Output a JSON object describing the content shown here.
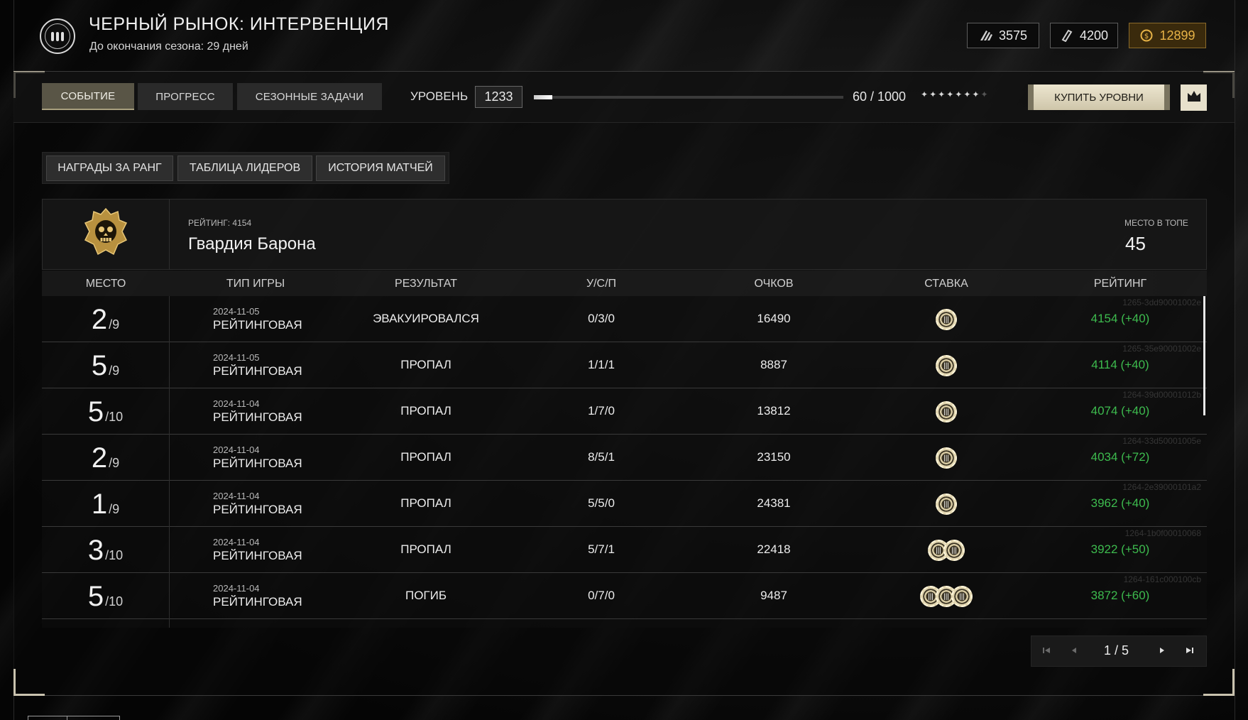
{
  "header": {
    "title": "ЧЕРНЫЙ РЫНОК: ИНТЕРВЕНЦИЯ",
    "subtitle": "До окончания сезона: 29 дней",
    "currencies": [
      {
        "icon": "ammo-icon",
        "value": "3575"
      },
      {
        "icon": "ticket-icon",
        "value": "4200"
      },
      {
        "icon": "gold-coin-icon",
        "value": "12899",
        "color": "#e7b347"
      }
    ]
  },
  "nav": {
    "tabs": [
      "СОБЫТИЕ",
      "ПРОГРЕСС",
      "СЕЗОННЫЕ ЗАДАЧИ"
    ],
    "active_tab": "СОБЫТИЕ",
    "level_label": "УРОВЕНЬ",
    "level_value": "1233",
    "progress_current": 60,
    "progress_max": 1000,
    "progress_text": "60 / 1000",
    "stars_filled": 7,
    "stars_total": 8,
    "buy_label": "КУПИТЬ УРОВНИ",
    "crown_icon": "crown-icon"
  },
  "subtabs": [
    "НАГРАДЫ ЗА РАНГ",
    "ТАБЛИЦА ЛИДЕРОВ",
    "ИСТОРИЯ МАТЧЕЙ"
  ],
  "team": {
    "rating_label": "РЕЙТИНГ: 4154",
    "name": "Гвардия Барона",
    "place_label": "МЕСТО В ТОПЕ",
    "place_value": "45",
    "emblem_icon": "skull-emblem-icon"
  },
  "table": {
    "columns": [
      "МЕСТО",
      "ТИП ИГРЫ",
      "РЕЗУЛЬТАТ",
      "У/С/П",
      "ОЧКОВ",
      "СТАВКА",
      "РЕЙТИНГ"
    ],
    "rows": [
      {
        "place": "2",
        "of": "/9",
        "date": "2024-11-05",
        "mode": "РЕЙТИНГОВАЯ",
        "result": "ЭВАКУИРОВАЛСЯ",
        "ksd": "0/3/0",
        "score": "16490",
        "chips": 1,
        "rating": "4154 (+40)",
        "id": "1265-3dd90001002e"
      },
      {
        "place": "5",
        "of": "/9",
        "date": "2024-11-05",
        "mode": "РЕЙТИНГОВАЯ",
        "result": "ПРОПАЛ",
        "ksd": "1/1/1",
        "score": "8887",
        "chips": 1,
        "rating": "4114 (+40)",
        "id": "1265-35e90001002e"
      },
      {
        "place": "5",
        "of": "/10",
        "date": "2024-11-04",
        "mode": "РЕЙТИНГОВАЯ",
        "result": "ПРОПАЛ",
        "ksd": "1/7/0",
        "score": "13812",
        "chips": 1,
        "rating": "4074 (+40)",
        "id": "1264-39d00001012b"
      },
      {
        "place": "2",
        "of": "/9",
        "date": "2024-11-04",
        "mode": "РЕЙТИНГОВАЯ",
        "result": "ПРОПАЛ",
        "ksd": "8/5/1",
        "score": "23150",
        "chips": 1,
        "rating": "4034 (+72)",
        "id": "1264-33d50001005e"
      },
      {
        "place": "1",
        "of": "/9",
        "date": "2024-11-04",
        "mode": "РЕЙТИНГОВАЯ",
        "result": "ПРОПАЛ",
        "ksd": "5/5/0",
        "score": "24381",
        "chips": 1,
        "rating": "3962 (+40)",
        "id": "1264-2e39000101a2"
      },
      {
        "place": "3",
        "of": "/10",
        "date": "2024-11-04",
        "mode": "РЕЙТИНГОВАЯ",
        "result": "ПРОПАЛ",
        "ksd": "5/7/1",
        "score": "22418",
        "chips": 2,
        "rating": "3922 (+50)",
        "id": "1264-1b0f00010068"
      },
      {
        "place": "5",
        "of": "/10",
        "date": "2024-11-04",
        "mode": "РЕЙТИНГОВАЯ",
        "result": "ПОГИБ",
        "ksd": "0/7/0",
        "score": "9487",
        "chips": 3,
        "rating": "3872 (+60)",
        "id": "1264-161c000100cb"
      }
    ],
    "rating_color": "#3dbb4e"
  },
  "pagination": {
    "text": "1 / 5",
    "first_icon": "first-page-icon",
    "prev_icon": "prev-page-icon",
    "next_icon": "next-page-icon",
    "last_icon": "last-page-icon"
  }
}
